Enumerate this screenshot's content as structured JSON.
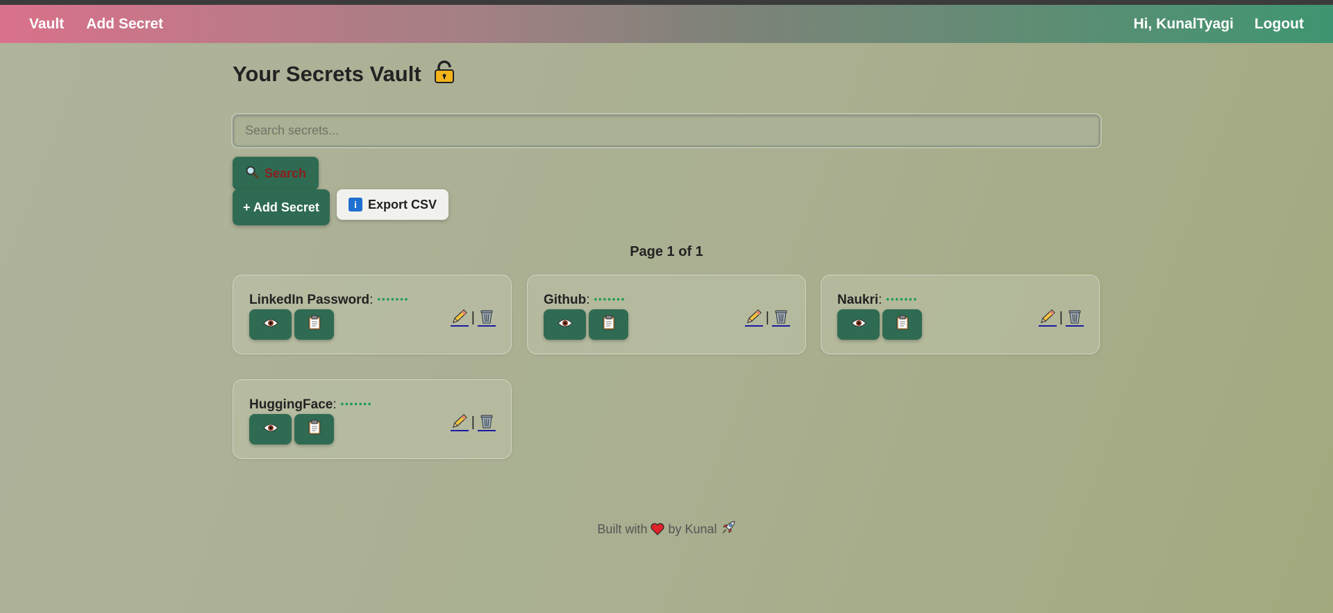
{
  "nav": {
    "brand": "Vault",
    "add_secret": "Add Secret",
    "greeting": "Hi, KunalTyagi",
    "logout": "Logout"
  },
  "main": {
    "title": "Your Secrets Vault",
    "title_icon": "lock-icon",
    "search_placeholder": "Search secrets...",
    "search_value": "",
    "search_button": "Search",
    "add_button": "+ Add Secret",
    "export_button": "Export CSV",
    "page_info": "Page 1 of 1"
  },
  "secrets": [
    {
      "name": "LinkedIn Password",
      "colon": ":",
      "masked": "•••••••"
    },
    {
      "name": "Github",
      "colon": ":",
      "masked": "•••••••"
    },
    {
      "name": "Naukri",
      "colon": ":",
      "masked": "•••••••"
    },
    {
      "name": "HuggingFace",
      "colon": ":",
      "masked": "•••••••"
    }
  ],
  "card_actions": {
    "view_icon": "eye-icon",
    "copy_icon": "clipboard-icon",
    "edit_icon": "pencil-icon",
    "delete_icon": "trash-icon",
    "separator": "|"
  },
  "footer": {
    "prefix": "Built with",
    "middle": "by Kunal",
    "heart_icon": "heart-icon",
    "rocket_icon": "rocket-icon"
  },
  "colors": {
    "accent_green": "#2f6b52",
    "mask_green": "#1d9b52",
    "nav_start": "#d9718b",
    "nav_end": "#3f9571"
  }
}
